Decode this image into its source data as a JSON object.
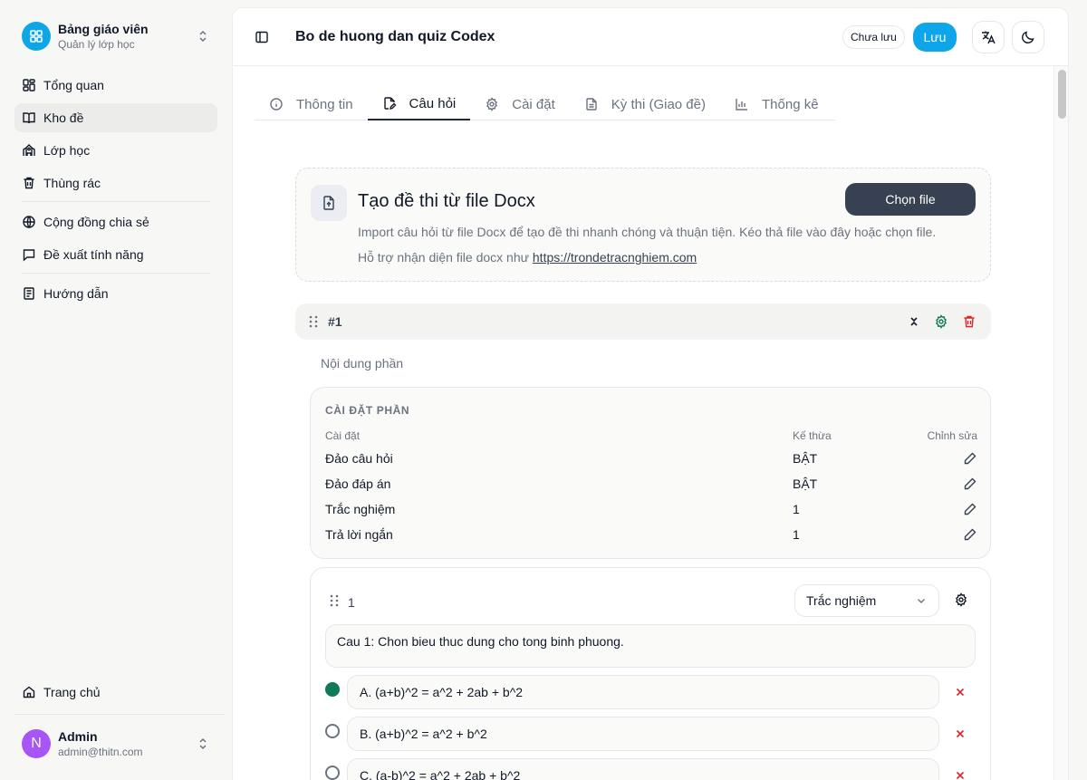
{
  "sidebar": {
    "brand_title": "Bảng giáo viên",
    "brand_subtitle": "Quản lý lớp học",
    "items": [
      {
        "label": "Tổng quan"
      },
      {
        "label": "Kho đề"
      },
      {
        "label": "Lớp học"
      },
      {
        "label": "Thùng rác"
      },
      {
        "label": "Cộng đồng chia sẻ"
      },
      {
        "label": "Đề xuất tính năng"
      },
      {
        "label": "Hướng dẫn"
      }
    ],
    "active_item": "Kho đề",
    "home_label": "Trang chủ",
    "user": {
      "initial": "N",
      "name": "Admin",
      "email": "admin@thitn.com"
    }
  },
  "header": {
    "title": "Bo de huong dan quiz Codex",
    "status": "Chưa lưu",
    "save_label": "Lưu"
  },
  "tabs": [
    {
      "label": "Thông tin"
    },
    {
      "label": "Câu hỏi"
    },
    {
      "label": "Cài đặt"
    },
    {
      "label": "Kỳ thi (Giao đề)"
    },
    {
      "label": "Thống kê"
    }
  ],
  "active_tab": "Câu hỏi",
  "import": {
    "title": "Tạo đề thi từ file Docx",
    "button": "Chọn file",
    "description": "Import câu hỏi từ file Docx để tạo đề thi nhanh chóng và thuận tiện. Kéo thả file vào đây hoặc chọn file.",
    "support_prefix": "Hỗ trợ nhận diện file docx như ",
    "support_link": "https://trondetracnghiem.com"
  },
  "section": {
    "number": "#1",
    "content_placeholder": "Nội dung phần",
    "settings": {
      "title": "CÀI ĐẶT PHẦN",
      "headers": {
        "setting": "Cài đặt",
        "inherit": "Kế thừa",
        "edit": "Chỉnh sửa"
      },
      "rows": [
        {
          "name": "Đảo câu hỏi",
          "value": "BẬT"
        },
        {
          "name": "Đảo đáp án",
          "value": "BẬT"
        },
        {
          "name": "Trắc nghiệm",
          "value": "1"
        },
        {
          "name": "Trả lời ngắn",
          "value": "1"
        }
      ]
    }
  },
  "question": {
    "number": "1",
    "type": "Trắc nghiệm",
    "text": "Cau 1: Chon bieu thuc dung cho tong binh phuong.",
    "answers": [
      {
        "text": "A. (a+b)^2 = a^2 + 2ab + b^2",
        "correct": true
      },
      {
        "text": "B. (a+b)^2 = a^2 + b^2",
        "correct": false
      },
      {
        "text": "C. (a-b)^2 = a^2 + 2ab + b^2",
        "correct": false
      }
    ]
  },
  "colors": {
    "accent": "#0ea5e9",
    "correct": "#0f7a53",
    "danger": "#dc2626",
    "dark_button": "#374151"
  }
}
